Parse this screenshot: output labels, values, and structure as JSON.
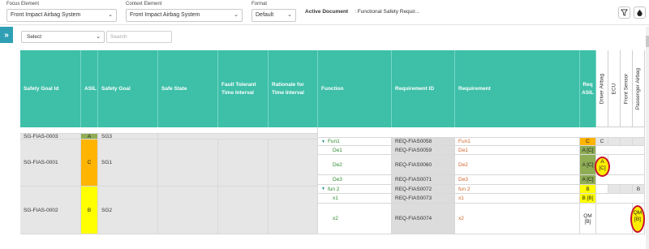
{
  "filters": {
    "focus": {
      "label": "Focus Element",
      "value": "Front Impact Airbag System"
    },
    "context": {
      "label": "Context Element",
      "value": "Front Impact Airbag System"
    },
    "format": {
      "label": "Format",
      "value": "Default"
    },
    "active_doc_label": "Active Document",
    "active_doc_value": ": Functional Safety Requir..."
  },
  "toolbar": {
    "expand_glyph": "»",
    "select_value": "Select",
    "search_placeholder": "Search"
  },
  "columns": {
    "sg_id": "Safety Goal Id",
    "asil": "ASIL",
    "sg": "Safety Goal",
    "safe_state": "Safe State",
    "ftti": "Fault Tolerant Time Interval",
    "rationale": "Rationale for Time Interval",
    "function": "Function",
    "req_id": "Requirement ID",
    "requirement": "Requirement",
    "req_asil": "Req ASIL",
    "alloc": [
      "Driver Airbag",
      "ECU",
      "Front Sensor",
      "Passenger Airbag"
    ]
  },
  "goals": [
    {
      "id": "SG-FIAS-0003",
      "asil": "A",
      "goal": "SG3"
    },
    {
      "id": "SG-FIAS-0001",
      "asil": "C",
      "goal": "SG1"
    },
    {
      "id": "SG-FIAS-0002",
      "asil": "B",
      "goal": "SG2"
    }
  ],
  "rows": [
    {
      "function": "Fun1",
      "req_id": "REQ-FIAS0058",
      "req": "Fun1",
      "req_asil": "C",
      "driver": "C",
      "ecu": "",
      "front": "",
      "passenger": ""
    },
    {
      "function": "De1",
      "req_id": "REQ-FIAS0059",
      "req": "De1",
      "req_asil": "A [C]",
      "driver": "",
      "ecu": "",
      "front": "",
      "passenger": ""
    },
    {
      "function": "De2",
      "req_id": "REQ-FIAS0060",
      "req": "De2",
      "req_asil": "A [C]",
      "driver": "A [C]",
      "ecu": "",
      "front": "",
      "passenger": ""
    },
    {
      "function": "De3",
      "req_id": "REQ-FIAS0071",
      "req": "De3",
      "req_asil": "A [C]",
      "driver": "",
      "ecu": "",
      "front": "",
      "passenger": ""
    },
    {
      "function": "fun 2",
      "req_id": "REQ-FIAS0072",
      "req": "fun 2",
      "req_asil": "B",
      "driver": "",
      "ecu": "",
      "front": "",
      "passenger": "B"
    },
    {
      "function": "x1",
      "req_id": "REQ-FIAS0073",
      "req": "x1",
      "req_asil": "B [B]",
      "driver": "",
      "ecu": "",
      "front": "",
      "passenger": ""
    },
    {
      "function": "x2",
      "req_id": "REQ-FIAS0074",
      "req": "x2",
      "req_asil": "QM [B]",
      "driver": "",
      "ecu": "",
      "front": "",
      "passenger": "QM [B]"
    }
  ]
}
